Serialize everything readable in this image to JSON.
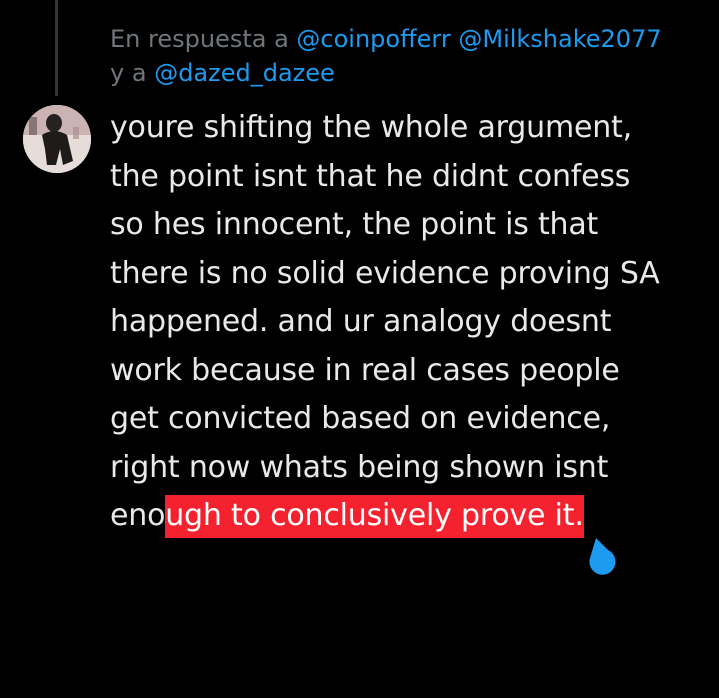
{
  "reply_context": {
    "prefix": "En respuesta a",
    "mention_1": "@coinpofferr",
    "mention_2": "@Milkshake2077",
    "connector": "y a",
    "mention_3": "@dazed_dazee"
  },
  "tweet": {
    "lines": [
      "youre shifting the whole argument,",
      "the point isnt that he didnt confess",
      "so hes innocent, the point is that",
      "there is no solid evidence proving SA",
      "happened. and ur analogy doesnt",
      "work because in real cases people",
      "get convicted based on evidence,",
      "right now whats being shown isnt"
    ],
    "last_line_plain": "eno",
    "last_line_selected": "ugh to conclusively prove it."
  },
  "colors": {
    "background": "#000000",
    "text": "#e7e9ea",
    "muted": "#71767b",
    "link": "#1d9bf0",
    "selection": "#f4212e",
    "handle": "#1d9bf0"
  }
}
